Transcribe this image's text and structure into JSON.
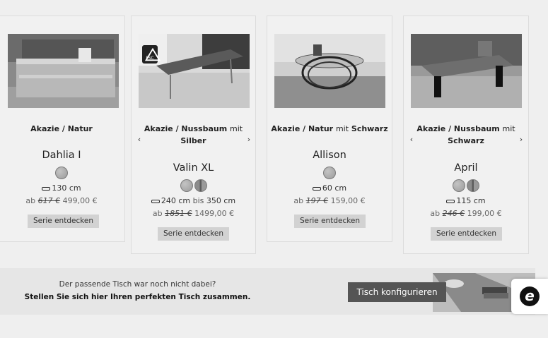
{
  "products": [
    {
      "material": "Akazie / Natur",
      "name": "Dahlia I",
      "length": "130 cm",
      "price_prefix": "ab",
      "old_price": "617 €",
      "price": "499,00 €",
      "button": "Serie entdecken",
      "swatches": [
        "natur"
      ]
    },
    {
      "material": "Akazie / Nussbaum",
      "mit": "mit",
      "material2": "Silber",
      "name": "Valin XL",
      "length": "240 cm",
      "length_bis": "bis",
      "length2": "350 cm",
      "price_prefix": "ab",
      "old_price": "1851 €",
      "price": "1499,00 €",
      "button": "Serie entdecken",
      "swatches": [
        "natur",
        "nussbaum"
      ],
      "badge": "FSC",
      "prev_icon": "‹",
      "next_icon": "›"
    },
    {
      "material": "Akazie / Natur",
      "mit": "mit",
      "material2": "Schwarz",
      "name": "Allison",
      "length": "60 cm",
      "price_prefix": "ab",
      "old_price": "197 €",
      "price": "159,00 €",
      "button": "Serie entdecken",
      "swatches": [
        "natur"
      ]
    },
    {
      "material": "Akazie / Nussbaum",
      "mit": "mit",
      "material2": "Schwarz",
      "name": "April",
      "length": "115 cm",
      "price_prefix": "ab",
      "old_price": "246 €",
      "price": "199,00 €",
      "button": "Serie entdecken",
      "swatches": [
        "natur",
        "nussbaum"
      ],
      "prev_icon": "‹",
      "next_icon": "›"
    }
  ],
  "banner": {
    "question": "Der passende Tisch war noch nicht dabei?",
    "prompt": "Stellen Sie sich hier Ihren perfekten Tisch zusammen.",
    "cta": "Tisch konfigurieren"
  },
  "trust_badge": {
    "letter": "e",
    "icon": "trusted-shops-icon"
  }
}
